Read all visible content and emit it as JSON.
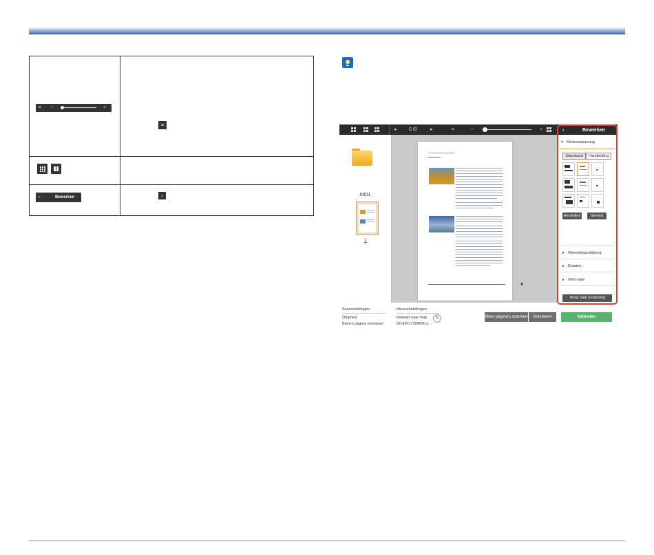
{
  "toolbar": {
    "page_counter": "0 /0",
    "zoom_minus": "−",
    "zoom_plus": "+"
  },
  "thumbnails": {
    "folder_label": "0001",
    "page_number": "1"
  },
  "panel": {
    "title": "Bewerken",
    "color_section": "Kleuraanpassing",
    "modes": [
      "Standaard",
      "Handleiding"
    ],
    "reset_button": "Herstellen",
    "done_button": "Gereed",
    "crop_section": "Afbeeldingsuitlijning",
    "rotate_section": "Draaien",
    "info_section": "Informatie",
    "restore_button": "Terug naar oorsprong"
  },
  "footer": {
    "scan_settings_label": "Scaninstellingen",
    "scan_setting_1": "Origineel",
    "scan_setting_2": "Blanco pagina overslaan",
    "output_settings_label": "Uitvoerinstellingen",
    "output_setting_1": "Opslaan naar map",
    "output_setting_2": "20142017058656.p...",
    "more_pages_button": "Meer pagina's scannen",
    "cancel_button": "Annuleren",
    "finish_button": "Voltooien"
  },
  "doc_table": {
    "edit_button_label": "Bewerken"
  },
  "colors": {
    "accent_red": "#d63c3c",
    "finish_green": "#56b36a",
    "toolbar_dark": "#2b2b2b",
    "header_blue": "#24519b"
  }
}
